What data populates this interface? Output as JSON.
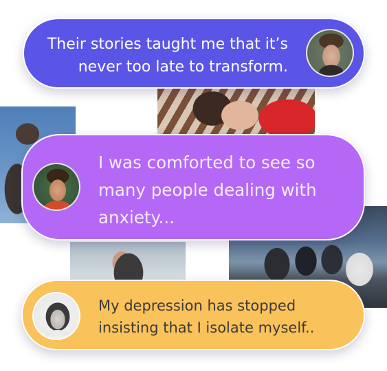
{
  "testimonials": [
    {
      "lines": [
        "Their stories taught me that it’s",
        "never too late to transform."
      ],
      "avatar_icon": "man-portrait-avatar",
      "color": "#5a55e6"
    },
    {
      "lines": [
        "I was comforted to see so",
        "many people dealing with",
        "anxiety..."
      ],
      "avatar_icon": "smiling-man-portrait-avatar",
      "color": "#b468f5"
    },
    {
      "lines": [
        "My depression has stopped",
        "insisting that I isolate myself.."
      ],
      "avatar_icon": "woman-portrait-avatar",
      "color": "#fac25a"
    }
  ],
  "background_photos": [
    "people-outdoors-photo",
    "friends-lying-together-photo",
    "couple-hugging-photo",
    "group-on-mountain-photo"
  ]
}
